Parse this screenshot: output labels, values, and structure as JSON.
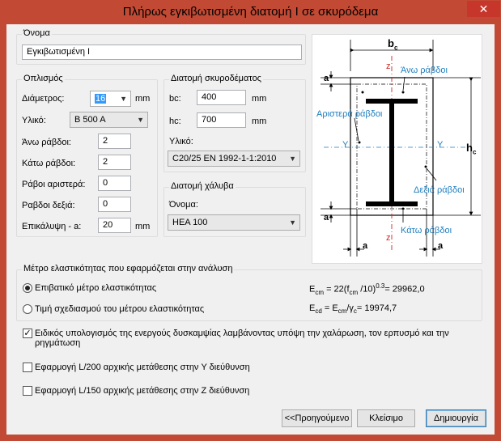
{
  "window": {
    "title": "Πλήρως εγκιβωτισμένη διατομή I σε σκυρόδεμα",
    "close_glyph": "✕"
  },
  "name_group": {
    "legend": "Όνομα",
    "value": "Εγκιβωτισμένη I"
  },
  "rebar": {
    "legend": "Οπλισμός",
    "diameter_label": "Διάμετρος:",
    "diameter_value": "16",
    "diameter_unit": "mm",
    "material_label": "Υλικό:",
    "material_value": "B 500 A",
    "top_label": "Άνω ράβδοι:",
    "top_value": "2",
    "bottom_label": "Κάτω ράβδοι:",
    "bottom_value": "2",
    "left_label": "Ράβοι αριστερά:",
    "left_value": "0",
    "right_label": "Ραβδοι δεξιά:",
    "right_value": "0",
    "cover_label": "Επικάλυψη - a:",
    "cover_value": "20",
    "cover_unit": "mm"
  },
  "concrete": {
    "legend": "Διατομή σκυροδέματος",
    "bc_label": "bc:",
    "bc_value": "400",
    "bc_unit": "mm",
    "hc_label": "hc:",
    "hc_value": "700",
    "hc_unit": "mm",
    "material_label": "Υλικό:",
    "material_value": "C20/25  EN 1992-1-1:2010"
  },
  "steel": {
    "legend": "Διατομή χάλυβα",
    "name_label": "Όνομα:",
    "name_value": "HEA 100"
  },
  "diagram": {
    "bc": "b",
    "bc_sub": "c",
    "hc": "h",
    "hc_sub": "c",
    "a": "a",
    "z": "z",
    "y": "Y",
    "top_bars": "Άνω ράβδοι",
    "left_bars": "Αριστερά ράβδοι",
    "right_bars": "Δεξιά ράβδοι",
    "bottom_bars": "Κάτω ράβδοι"
  },
  "elastic": {
    "legend": "Μέτρο ελαστικότητας που εφαρμόζεται στην ανάλυση",
    "option1": "Επιβατικό μέτρο ελαστικότητας",
    "option2": "Τιμή σχεδιασμού του μέτρου ελαστικότητας",
    "formula1_lhs": "E",
    "formula1_lhs_sub": "cm",
    "formula1_mid": " = 22(f",
    "formula1_f_sub": "cm",
    "formula1_rest": " /10)",
    "formula1_sup": "0.3",
    "formula1_result": "= 29962,0",
    "formula2_lhs": "E",
    "formula2_lhs_sub": "cd",
    "formula2_mid": " = E",
    "formula2_mid_sub": "cm",
    "formula2_slash": "/",
    "formula2_gamma": "γ",
    "formula2_gamma_sub": "c",
    "formula2_result": "= 19974,7",
    "selected": 1
  },
  "checks": {
    "special": "Ειδικός υπολογισμός της ενεργούς δυσκαμψίας λαμβάνοντας υπόψη την χαλάρωση, τον ερπυσμό και την ρηγμάτωση",
    "special_checked": true,
    "l200": "Εφαρμογή L/200 αρχικής μετάθεσης στην Y διεύθυνση",
    "l200_checked": false,
    "l150": "Εφαρμογή L/150 αρχικής μετάθεσης στην Z διεύθυνση",
    "l150_checked": false
  },
  "buttons": {
    "prev": "<<Προηγούμενο",
    "close": "Κλείσιμο",
    "create": "Δημιουργία"
  },
  "colors": {
    "title_bg": "#c24a34",
    "accent_blue": "#1f7fbf",
    "axis_red": "#d42020"
  }
}
